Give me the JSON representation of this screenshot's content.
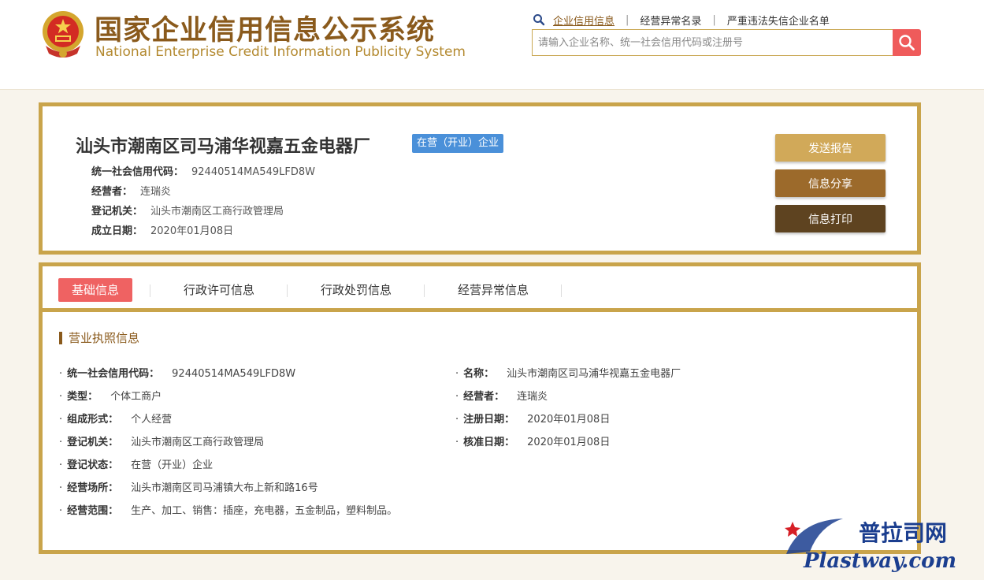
{
  "header": {
    "title_cn": "国家企业信用信息公示系统",
    "title_en": "National Enterprise Credit Information Publicity System",
    "nav": [
      {
        "label": "企业信用信息",
        "active": true
      },
      {
        "label": "经营异常名录",
        "active": false
      },
      {
        "label": "严重违法失信企业名单",
        "active": false
      }
    ],
    "search_placeholder": "请输入企业名称、统一社会信用代码或注册号"
  },
  "company": {
    "name": "汕头市潮南区司马浦华视嘉五金电器厂",
    "status": "在营（开业）企业",
    "rows": [
      {
        "label": "统一社会信用代码：",
        "value": "92440514MA549LFD8W"
      },
      {
        "label": "经营者：",
        "value": "连瑞炎"
      },
      {
        "label": "登记机关：",
        "value": "汕头市潮南区工商行政管理局"
      },
      {
        "label": "成立日期：",
        "value": "2020年01月08日"
      }
    ],
    "actions": [
      {
        "label": "发送报告",
        "color": "#d1a959"
      },
      {
        "label": "信息分享",
        "color": "#9c6a2b"
      },
      {
        "label": "信息打印",
        "color": "#5e4320"
      }
    ]
  },
  "tabs": [
    {
      "label": "基础信息",
      "active": true
    },
    {
      "label": "行政许可信息",
      "active": false
    },
    {
      "label": "行政处罚信息",
      "active": false
    },
    {
      "label": "经营异常信息",
      "active": false
    }
  ],
  "license": {
    "section_title": "营业执照信息",
    "left": [
      {
        "label": "统一社会信用代码：",
        "value": "92440514MA549LFD8W"
      },
      {
        "label": "类型：",
        "value": "个体工商户"
      },
      {
        "label": "组成形式：",
        "value": "个人经营"
      },
      {
        "label": "登记机关：",
        "value": "汕头市潮南区工商行政管理局"
      },
      {
        "label": "登记状态：",
        "value": "在营（开业）企业"
      },
      {
        "label": "经营场所：",
        "value": "汕头市潮南区司马浦镇大布上新和路16号"
      },
      {
        "label": "经营范围：",
        "value": "生产、加工、销售：插座，充电器，五金制品，塑料制品。"
      }
    ],
    "right": [
      {
        "label": "名称：",
        "value": "汕头市潮南区司马浦华视嘉五金电器厂"
      },
      {
        "label": "经营者：",
        "value": "连瑞炎"
      },
      {
        "label": "注册日期：",
        "value": "2020年01月08日"
      },
      {
        "label": "核准日期：",
        "value": "2020年01月08日"
      }
    ]
  },
  "watermark": {
    "cn": "普拉司网",
    "en": "Plastway.com"
  },
  "icons": {
    "emblem": "national-emblem-icon",
    "magnifier": "search-icon"
  },
  "colors": {
    "gold": "#c9a44b",
    "brown": "#8a5a1c",
    "badge": "#4a90d9",
    "active_tab": "#ef6262",
    "search_btn": "#ef5b5b"
  }
}
